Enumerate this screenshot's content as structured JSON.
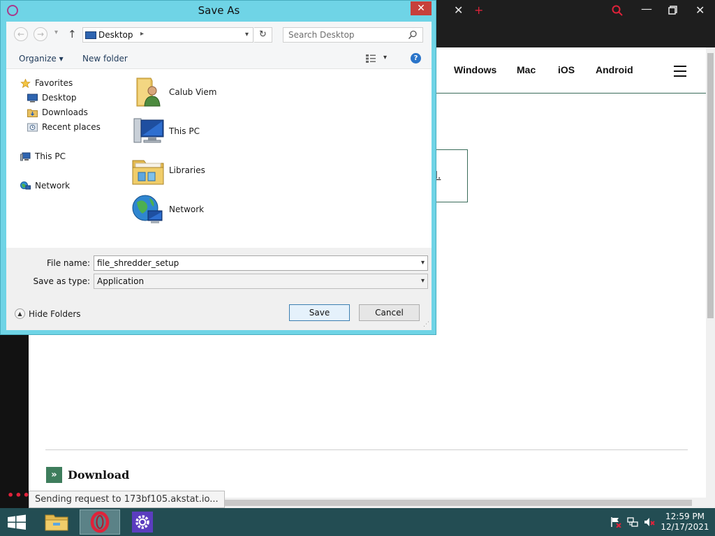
{
  "browser": {
    "nav_links": [
      "Windows",
      "Mac",
      "iOS",
      "Android"
    ],
    "card_link_fragment": "l.",
    "download_heading": "Download",
    "status_text": "Sending request to 173bf105.akstat.io..."
  },
  "dialog": {
    "title": "Save As",
    "close_label": "✕",
    "breadcrumb": {
      "location": "Desktop"
    },
    "search": {
      "placeholder": "Search Desktop"
    },
    "toolbar": {
      "organize_label": "Organize ▾",
      "new_folder_label": "New folder",
      "help_label": "?"
    },
    "nav_pane": {
      "favorites_label": "Favorites",
      "favorites": [
        "Desktop",
        "Downloads",
        "Recent places"
      ],
      "this_pc_label": "This PC",
      "network_label": "Network"
    },
    "files": [
      "Calub Viem",
      "This PC",
      "Libraries",
      "Network"
    ],
    "file_name_label": "File name:",
    "file_name_value": "file_shredder_setup",
    "save_type_label": "Save as type:",
    "save_type_value": "Application",
    "hide_folders_label": "Hide Folders",
    "save_button": "Save",
    "cancel_button": "Cancel"
  },
  "taskbar": {
    "clock_time": "12:59 PM",
    "clock_date": "12/17/2021"
  },
  "colors": {
    "dialog_frame": "#6fd4e6",
    "close_button": "#c7403b",
    "taskbar": "#234d53",
    "browser_accent": "#e0223a",
    "page_accent": "#3e7d5c"
  }
}
